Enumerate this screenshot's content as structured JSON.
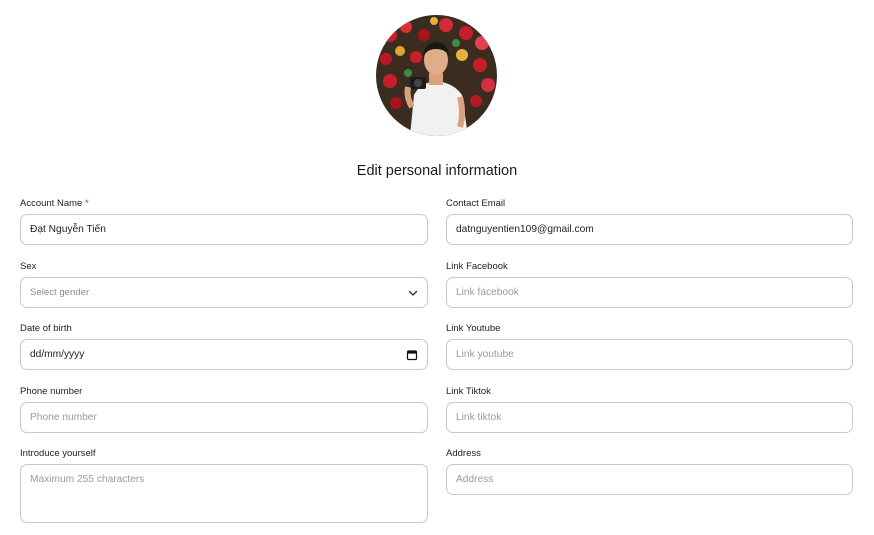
{
  "title": "Edit personal information",
  "form": {
    "account_name": {
      "label": "Account Name",
      "required_mark": "*",
      "value": "Đạt Nguyễn Tiến"
    },
    "contact_email": {
      "label": "Contact Email",
      "value": "datnguyentien109@gmail.com"
    },
    "sex": {
      "label": "Sex",
      "placeholder": "Select gender"
    },
    "link_facebook": {
      "label": "Link Facebook",
      "placeholder": "Link facebook"
    },
    "date_of_birth": {
      "label": "Date of birth",
      "value": "dd/mm/yyyy"
    },
    "link_youtube": {
      "label": "Link Youtube",
      "placeholder": "Link youtube"
    },
    "phone_number": {
      "label": "Phone number",
      "placeholder": "Phone number"
    },
    "link_tiktok": {
      "label": "Link Tiktok",
      "placeholder": "Link tiktok"
    },
    "introduce": {
      "label": "Introduce yourself",
      "placeholder": "Maximum 255 characters"
    },
    "address": {
      "label": "Address",
      "placeholder": "Address"
    }
  },
  "icons": {
    "select_arrow": "chevron-down-icon",
    "date_picker": "calendar-icon"
  }
}
